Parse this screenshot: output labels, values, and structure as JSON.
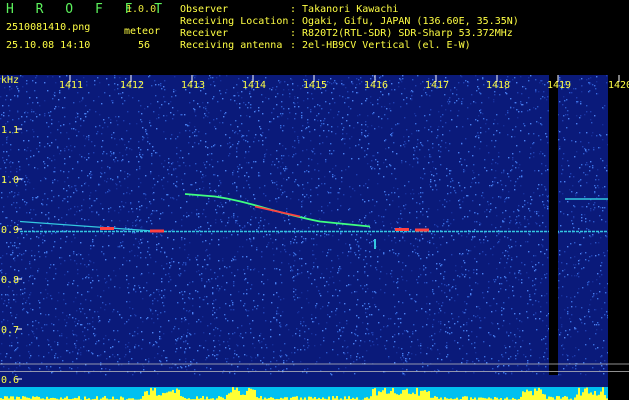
{
  "header": {
    "app_name": "H R O F F T",
    "version": "1.0.0",
    "filename": "2510081410.png",
    "datetime": "25.10.08 14:10",
    "count_label": "meteor",
    "count_value": "56"
  },
  "info": [
    {
      "label": "Observer",
      "value": ": Takanori Kawachi"
    },
    {
      "label": "Receiving Location",
      "value": ": Ogaki, Gifu, JAPAN (136.60E, 35.35N)"
    },
    {
      "label": "Receiver",
      "value": ": R820T2(RTL-SDR) SDR-Sharp 53.372MHz"
    },
    {
      "label": "Receiving antenna",
      "value": ": 2el-HB9CV Vertical (el. E-W)"
    }
  ],
  "spectrogram": {
    "unit_label": "kHz",
    "time_ticks": [
      "1411",
      "1412",
      "1413",
      "1414",
      "1415",
      "1416",
      "1417",
      "1418",
      "1419",
      "1420"
    ],
    "freq_ticks": [
      "1.1",
      "1.0",
      "0.9",
      "0.8",
      "0.7",
      "0.6"
    ],
    "colors": {
      "background": "#0a1a7a",
      "noise": "#2a56c8",
      "carrier": "#33c8e0",
      "signal_hot": "#ff4040",
      "signal_mid": "#40ff80",
      "gap": "#000000",
      "level_bar": "#ffff33",
      "level_base": "#00c0f0"
    }
  }
}
